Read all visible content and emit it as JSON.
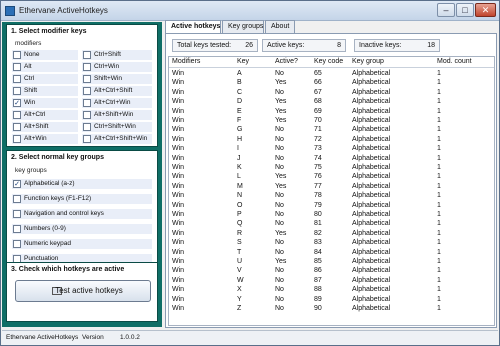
{
  "window": {
    "title": "Ethervane ActiveHotkeys"
  },
  "sections": {
    "modifier": {
      "title": "1. Select modifier keys",
      "subtitle": "modifiers",
      "left": [
        {
          "label": "None",
          "checked": false
        },
        {
          "label": "Alt",
          "checked": false
        },
        {
          "label": "Ctrl",
          "checked": false
        },
        {
          "label": "Shift",
          "checked": false
        },
        {
          "label": "Win",
          "checked": true
        },
        {
          "label": "Alt+Ctrl",
          "checked": false
        },
        {
          "label": "Alt+Shift",
          "checked": false
        },
        {
          "label": "Alt+Win",
          "checked": false
        }
      ],
      "right": [
        {
          "label": "Ctrl+Shift",
          "checked": false
        },
        {
          "label": "Ctrl+Win",
          "checked": false
        },
        {
          "label": "Shift+Win",
          "checked": false
        },
        {
          "label": "Alt+Ctrl+Shift",
          "checked": false
        },
        {
          "label": "Alt+Ctrl+Win",
          "checked": false
        },
        {
          "label": "Alt+Shift+Win",
          "checked": false
        },
        {
          "label": "Ctrl+Shift+Win",
          "checked": false
        },
        {
          "label": "Alt+Ctrl+Shift+Win",
          "checked": false
        }
      ]
    },
    "keygroups": {
      "title": "2. Select normal key groups",
      "subtitle": "key groups",
      "items": [
        {
          "label": "Alphabetical (a-z)",
          "checked": true
        },
        {
          "label": "Function keys (F1-F12)",
          "checked": false
        },
        {
          "label": "Navigation and control keys",
          "checked": false
        },
        {
          "label": "Numbers (0-9)",
          "checked": false
        },
        {
          "label": "Numeric keypad",
          "checked": false
        },
        {
          "label": "Punctuation",
          "checked": false
        }
      ]
    },
    "check": {
      "title": "3. Check which hotkeys are active",
      "button_label": "Test active hotkeys"
    }
  },
  "tabs": [
    {
      "label": "Active hotkeys",
      "active": true
    },
    {
      "label": "Key groups",
      "active": false
    },
    {
      "label": "About",
      "active": false
    }
  ],
  "stats": {
    "tested_label": "Total keys tested:",
    "tested_value": "26",
    "active_label": "Active keys:",
    "active_value": "8",
    "inactive_label": "Inactive keys:",
    "inactive_value": "18"
  },
  "table": {
    "columns": [
      "Modifiers",
      "Key",
      "Active?",
      "Key code",
      "Key group",
      "Mod. count"
    ],
    "rows": [
      [
        "Win",
        "A",
        "No",
        "65",
        "Alphabetical",
        "1"
      ],
      [
        "Win",
        "B",
        "Yes",
        "66",
        "Alphabetical",
        "1"
      ],
      [
        "Win",
        "C",
        "No",
        "67",
        "Alphabetical",
        "1"
      ],
      [
        "Win",
        "D",
        "Yes",
        "68",
        "Alphabetical",
        "1"
      ],
      [
        "Win",
        "E",
        "Yes",
        "69",
        "Alphabetical",
        "1"
      ],
      [
        "Win",
        "F",
        "Yes",
        "70",
        "Alphabetical",
        "1"
      ],
      [
        "Win",
        "G",
        "No",
        "71",
        "Alphabetical",
        "1"
      ],
      [
        "Win",
        "H",
        "No",
        "72",
        "Alphabetical",
        "1"
      ],
      [
        "Win",
        "I",
        "No",
        "73",
        "Alphabetical",
        "1"
      ],
      [
        "Win",
        "J",
        "No",
        "74",
        "Alphabetical",
        "1"
      ],
      [
        "Win",
        "K",
        "No",
        "75",
        "Alphabetical",
        "1"
      ],
      [
        "Win",
        "L",
        "Yes",
        "76",
        "Alphabetical",
        "1"
      ],
      [
        "Win",
        "M",
        "Yes",
        "77",
        "Alphabetical",
        "1"
      ],
      [
        "Win",
        "N",
        "No",
        "78",
        "Alphabetical",
        "1"
      ],
      [
        "Win",
        "O",
        "No",
        "79",
        "Alphabetical",
        "1"
      ],
      [
        "Win",
        "P",
        "No",
        "80",
        "Alphabetical",
        "1"
      ],
      [
        "Win",
        "Q",
        "No",
        "81",
        "Alphabetical",
        "1"
      ],
      [
        "Win",
        "R",
        "Yes",
        "82",
        "Alphabetical",
        "1"
      ],
      [
        "Win",
        "S",
        "No",
        "83",
        "Alphabetical",
        "1"
      ],
      [
        "Win",
        "T",
        "No",
        "84",
        "Alphabetical",
        "1"
      ],
      [
        "Win",
        "U",
        "Yes",
        "85",
        "Alphabetical",
        "1"
      ],
      [
        "Win",
        "V",
        "No",
        "86",
        "Alphabetical",
        "1"
      ],
      [
        "Win",
        "W",
        "No",
        "87",
        "Alphabetical",
        "1"
      ],
      [
        "Win",
        "X",
        "No",
        "88",
        "Alphabetical",
        "1"
      ],
      [
        "Win",
        "Y",
        "No",
        "89",
        "Alphabetical",
        "1"
      ],
      [
        "Win",
        "Z",
        "No",
        "90",
        "Alphabetical",
        "1"
      ]
    ]
  },
  "status": {
    "app": "Ethervane ActiveHotkeys",
    "version_label": "Version",
    "version": "1.0.0.2"
  }
}
